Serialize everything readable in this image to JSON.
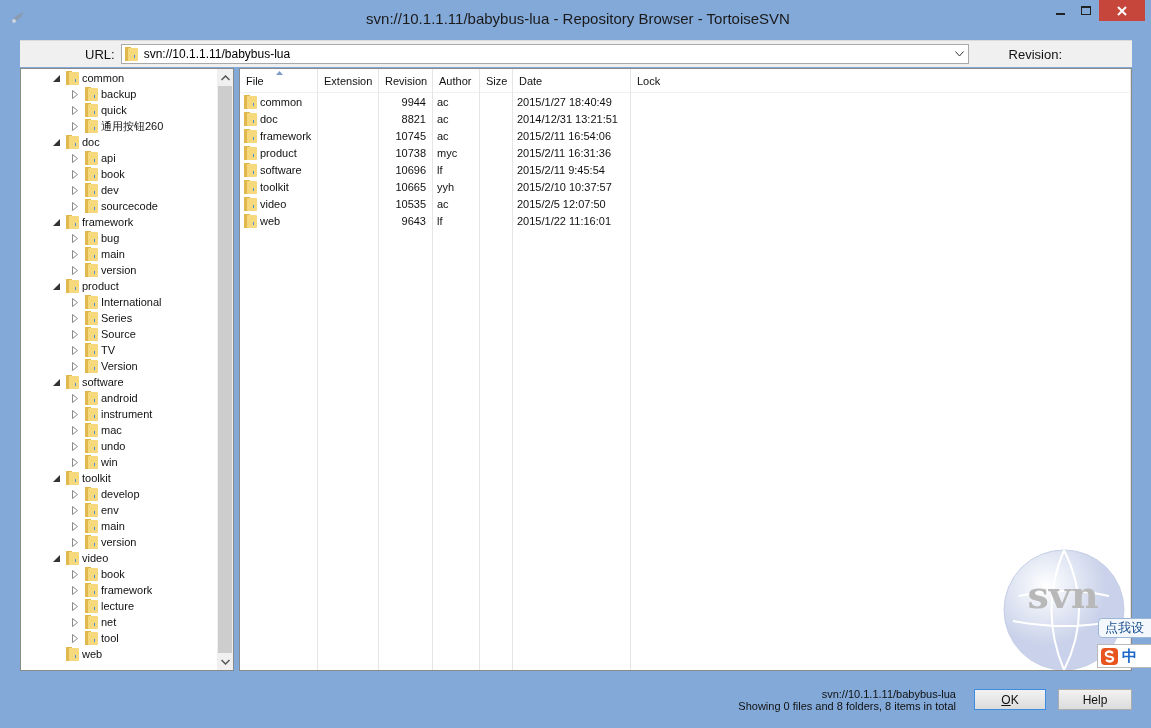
{
  "window": {
    "title": "svn://10.1.1.11/babybus-lua - Repository Browser - TortoiseSVN"
  },
  "url_bar": {
    "label": "URL:",
    "value": "svn://10.1.1.11/babybus-lua",
    "revision_label": "Revision:"
  },
  "tree": [
    {
      "name": "common",
      "expanded": true,
      "children": [
        {
          "name": "backup",
          "expanded": false
        },
        {
          "name": "quick",
          "expanded": false
        },
        {
          "name": "通用按钮260",
          "expanded": false
        }
      ]
    },
    {
      "name": "doc",
      "expanded": true,
      "children": [
        {
          "name": "api",
          "expanded": false
        },
        {
          "name": "book",
          "expanded": false
        },
        {
          "name": "dev",
          "expanded": false
        },
        {
          "name": "sourcecode",
          "expanded": false
        }
      ]
    },
    {
      "name": "framework",
      "expanded": true,
      "children": [
        {
          "name": "bug",
          "expanded": false
        },
        {
          "name": "main",
          "expanded": false
        },
        {
          "name": "version",
          "expanded": false
        }
      ]
    },
    {
      "name": "product",
      "expanded": true,
      "children": [
        {
          "name": "International",
          "expanded": false
        },
        {
          "name": "Series",
          "expanded": false
        },
        {
          "name": "Source",
          "expanded": false
        },
        {
          "name": "TV",
          "expanded": false
        },
        {
          "name": "Version",
          "expanded": false
        }
      ]
    },
    {
      "name": "software",
      "expanded": true,
      "children": [
        {
          "name": "android",
          "expanded": false
        },
        {
          "name": "instrument",
          "expanded": false
        },
        {
          "name": "mac",
          "expanded": false
        },
        {
          "name": "undo",
          "expanded": false
        },
        {
          "name": "win",
          "expanded": false
        }
      ]
    },
    {
      "name": "toolkit",
      "expanded": true,
      "children": [
        {
          "name": "develop",
          "expanded": false
        },
        {
          "name": "env",
          "expanded": false
        },
        {
          "name": "main",
          "expanded": false
        },
        {
          "name": "version",
          "expanded": false
        }
      ]
    },
    {
      "name": "video",
      "expanded": true,
      "children": [
        {
          "name": "book",
          "expanded": false
        },
        {
          "name": "framework",
          "expanded": false
        },
        {
          "name": "lecture",
          "expanded": false
        },
        {
          "name": "net",
          "expanded": false
        },
        {
          "name": "tool",
          "expanded": false
        }
      ]
    },
    {
      "name": "web"
    }
  ],
  "table": {
    "columns": [
      "File",
      "Extension",
      "Revision",
      "Author",
      "Size",
      "Date",
      "Lock"
    ],
    "rows": [
      [
        "common",
        "",
        "9944",
        "ac",
        "",
        "2015/1/27 18:40:49",
        ""
      ],
      [
        "doc",
        "",
        "8821",
        "ac",
        "",
        "2014/12/31 13:21:51",
        ""
      ],
      [
        "framework",
        "",
        "10745",
        "ac",
        "",
        "2015/2/11 16:54:06",
        ""
      ],
      [
        "product",
        "",
        "10738",
        "myc",
        "",
        "2015/2/11 16:31:36",
        ""
      ],
      [
        "software",
        "",
        "10696",
        "lf",
        "",
        "2015/2/11 9:45:54",
        ""
      ],
      [
        "toolkit",
        "",
        "10665",
        "yyh",
        "",
        "2015/2/10 10:37:57",
        ""
      ],
      [
        "video",
        "",
        "10535",
        "ac",
        "",
        "2015/2/5 12:07:50",
        ""
      ],
      [
        "web",
        "",
        "9643",
        "lf",
        "",
        "2015/1/22 11:16:01",
        ""
      ]
    ]
  },
  "logo_text": "svn",
  "status": {
    "url": "svn://10.1.1.11/babybus-lua",
    "summary": "Showing 0 files and 8 folders, 8 items in total"
  },
  "buttons": [
    "OK",
    "Help"
  ],
  "ime": {
    "tooltip": "点我设",
    "mode": "中"
  }
}
